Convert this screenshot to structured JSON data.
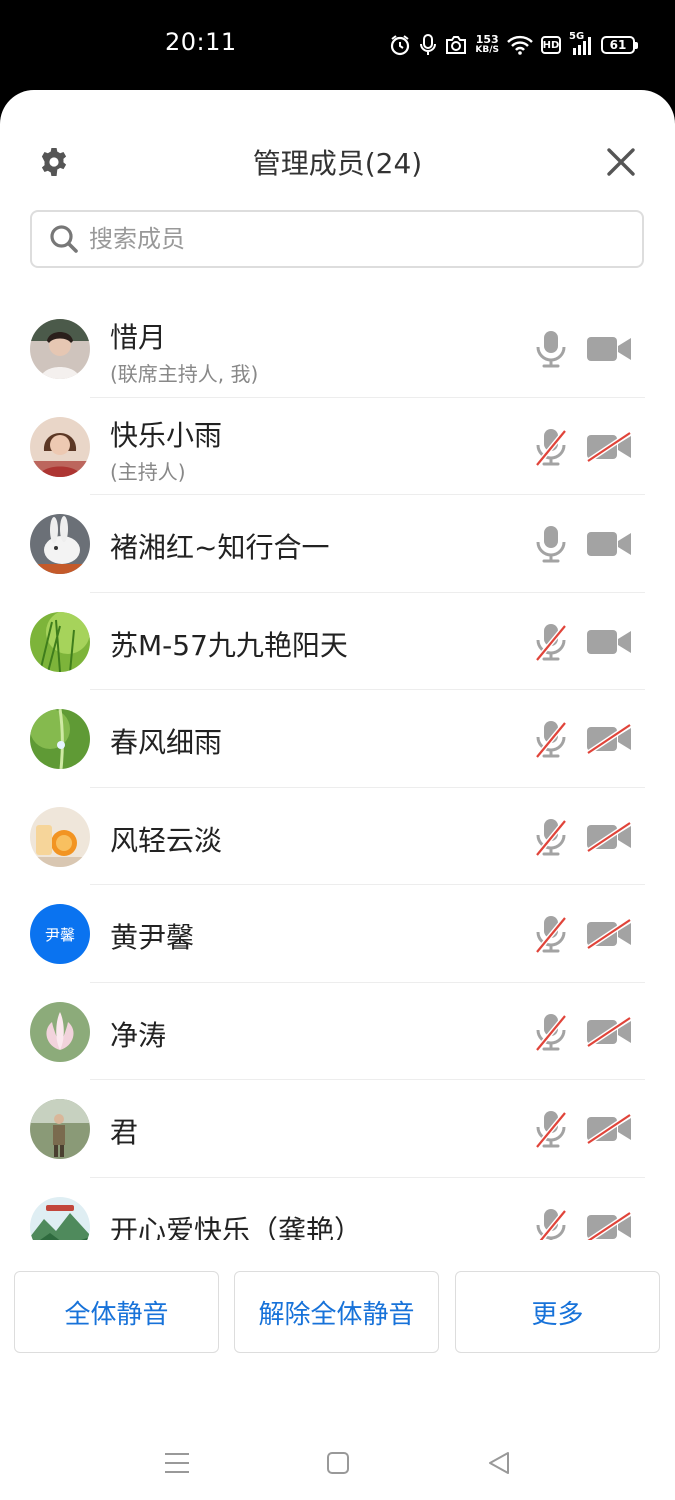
{
  "status_bar": {
    "time": "20:11",
    "net_speed_value": "153",
    "net_speed_unit": "KB/S",
    "hd_label": "HD",
    "signal_label": "5G",
    "battery": "61"
  },
  "header": {
    "title": "管理成员(24)"
  },
  "search": {
    "placeholder": "搜索成员"
  },
  "members": [
    {
      "name": "惜月",
      "role": "(联席主持人, 我)",
      "avatar": "photo-woman",
      "mic_muted": false,
      "cam_off": false
    },
    {
      "name": "快乐小雨",
      "role": "(主持人)",
      "avatar": "photo-woman-2",
      "mic_muted": true,
      "cam_off": true
    },
    {
      "name": "褚湘红~知行合一",
      "role": "",
      "avatar": "photo-rabbit",
      "mic_muted": false,
      "cam_off": false
    },
    {
      "name": "苏M-57九九艳阳天",
      "role": "",
      "avatar": "photo-grass",
      "mic_muted": true,
      "cam_off": false
    },
    {
      "name": "春风细雨",
      "role": "",
      "avatar": "photo-dewdrop",
      "mic_muted": true,
      "cam_off": true
    },
    {
      "name": "风轻云淡",
      "role": "",
      "avatar": "photo-orange",
      "mic_muted": true,
      "cam_off": true
    },
    {
      "name": "黄尹馨",
      "role": "",
      "avatar": "text",
      "avatar_text": "尹馨",
      "mic_muted": true,
      "cam_off": true
    },
    {
      "name": "净涛",
      "role": "",
      "avatar": "photo-lotus",
      "mic_muted": true,
      "cam_off": true
    },
    {
      "name": "君",
      "role": "",
      "avatar": "photo-person-outdoor",
      "mic_muted": true,
      "cam_off": true
    },
    {
      "name": "开心爱快乐（龚艳）",
      "role": "",
      "avatar": "photo-landscape",
      "mic_muted": true,
      "cam_off": true
    }
  ],
  "actions": {
    "mute_all": "全体静音",
    "unmute_all": "解除全体静音",
    "more": "更多"
  },
  "colors": {
    "accent": "#1772d9",
    "muted_slash": "#e0443a",
    "icon_gray": "#a3a3a3",
    "text_avatar_bg": "#0a73f0"
  }
}
